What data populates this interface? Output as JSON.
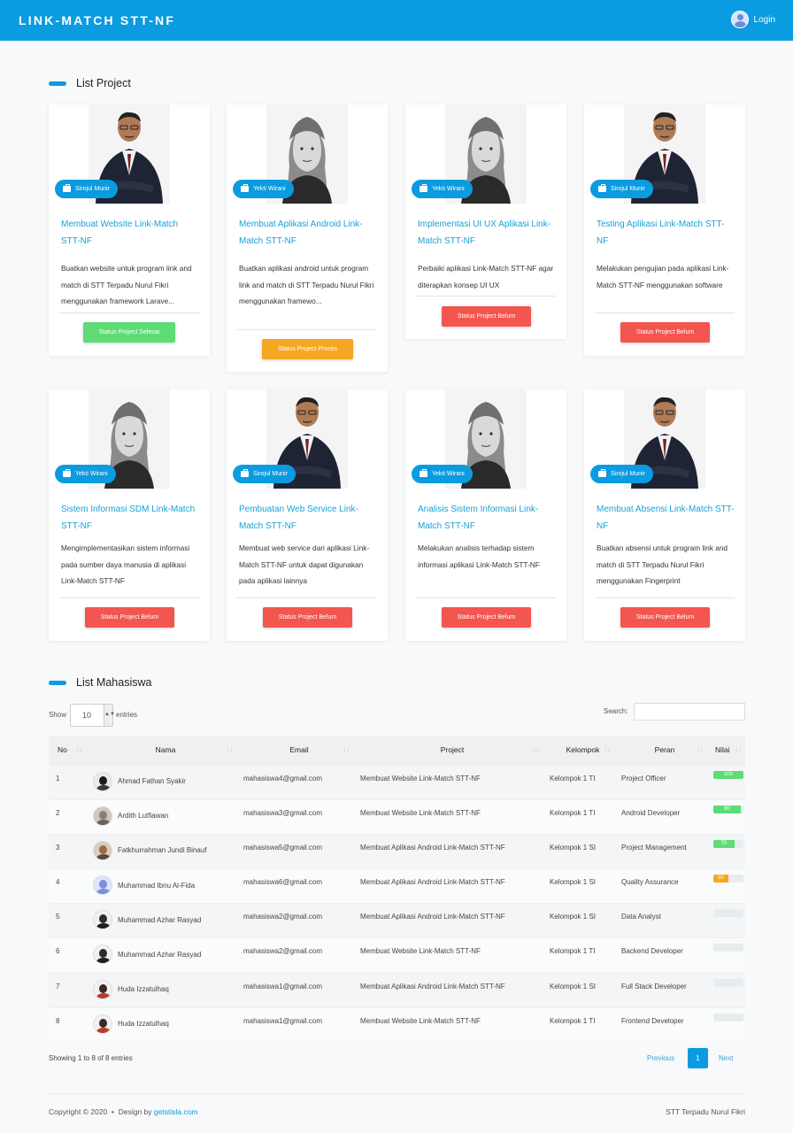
{
  "brand": "LINK-MATCH STT-NF",
  "login_label": "Login",
  "sections": {
    "projects": "List Project",
    "students": "List Mahasiswa"
  },
  "colors": {
    "primary": "#0b9be0",
    "selesai": "#5fdb76",
    "proses": "#f5a623",
    "belum": "#f2564f"
  },
  "projects": [
    {
      "owner": "Sirojul Munir",
      "owner_gender": "male",
      "title": "Membuat Website Link-Match STT-NF",
      "desc": "Buatkan website untuk program link and match di STT Terpadu Nurul Fikri menggunakan framework Larave...",
      "status": "Status Project Selesai",
      "status_type": "selesai"
    },
    {
      "owner": "Yekti Wirani",
      "owner_gender": "female",
      "title": "Membuat Aplikasi Android Link-Match STT-NF",
      "desc": "Buatkan aplikasi android untuk program link and match di STT Terpadu Nurul Fikri menggunakan framewo...",
      "status": "Status Project Proses",
      "status_type": "proses"
    },
    {
      "owner": "Yekti Wirani",
      "owner_gender": "female",
      "title": "Implementasi UI UX Aplikasi Link-Match STT-NF",
      "desc": "Perbaiki aplikasi Link-Match STT-NF agar diterapkan konsep UI UX",
      "status": "Status Project Belum",
      "status_type": "belum"
    },
    {
      "owner": "Sirojul Munir",
      "owner_gender": "male",
      "title": "Testing Aplikasi Link-Match STT-NF",
      "desc": "Melakukan pengujian pada aplikasi Link-Match STT-NF menggunakan software",
      "status": "Status Project Belum",
      "status_type": "belum"
    },
    {
      "owner": "Yekti Wirani",
      "owner_gender": "female",
      "title": "Sistem Informasi SDM Link-Match STT-NF",
      "desc": "Mengimplementasikan sistem informasi pada sumber daya manusia di aplikasi Link-Match STT-NF",
      "status": "Status Project Belum",
      "status_type": "belum"
    },
    {
      "owner": "Sirojul Munir",
      "owner_gender": "male",
      "title": "Pembuatan Web Service Link-Match STT-NF",
      "desc": "Membuat web service dari aplikasi Link-Match STT-NF untuk dapat digunakan pada aplikasi lainnya",
      "status": "Status Project Belum",
      "status_type": "belum"
    },
    {
      "owner": "Yekti Wirani",
      "owner_gender": "female",
      "title": "Analisis Sistem Informasi Link-Match STT-NF",
      "desc": "Melakukan analisis terhadap sistem informasi aplikasi Link-Match STT-NF",
      "status": "Status Project Belum",
      "status_type": "belum"
    },
    {
      "owner": "Sirojul Munir",
      "owner_gender": "male",
      "title": "Membuat Absensi Link-Match STT-NF",
      "desc": "Buatkan absensi untuk program link and match di STT Terpadu Nurul Fikri menggunakan Fingerprint",
      "status": "Status Project Belum",
      "status_type": "belum"
    }
  ],
  "table": {
    "show_label": "Show",
    "entries_value": "10",
    "entries_label": "entries",
    "search_label": "Search:",
    "search_value": "",
    "columns": [
      "No",
      "Nama",
      "Email",
      "Project",
      "Kelompok",
      "Peran",
      "Nilai"
    ],
    "rows": [
      {
        "no": "1",
        "nama": "Ahmad Fathan Syakir",
        "email": "mahasiswa4@gmail.com",
        "project": "Membuat Website Link-Match STT-NF",
        "kelompok": "Kelompok 1 TI",
        "peran": "Project Officer",
        "nilai": 100,
        "nilai_label": "100",
        "nilai_color": "#5fdb76",
        "avatar": "dark"
      },
      {
        "no": "2",
        "nama": "Ardith Lutfiawan",
        "email": "mahasiswa3@gmail.com",
        "project": "Membuat Website Link-Match STT-NF",
        "kelompok": "Kelompok 1 TI",
        "peran": "Android Developer",
        "nilai": 90,
        "nilai_label": "90",
        "nilai_color": "#5fdb76",
        "avatar": "grey"
      },
      {
        "no": "3",
        "nama": "Fatkhurrahman Jundi Binauf",
        "email": "mahasiswa5@gmail.com",
        "project": "Membuat Aplikasi Android Link-Match STT-NF",
        "kelompok": "Kelompok 1 SI",
        "peran": "Project Management",
        "nilai": 70,
        "nilai_label": "70",
        "nilai_color": "#5fdb76",
        "avatar": "tan"
      },
      {
        "no": "4",
        "nama": "Muhammad Ibnu Al-Fida",
        "email": "mahasiswa6@gmail.com",
        "project": "Membuat Aplikasi Android Link-Match STT-NF",
        "kelompok": "Kelompok 1 SI",
        "peran": "Quality Assurance",
        "nilai": 50,
        "nilai_label": "50",
        "nilai_color": "#f5a623",
        "avatar": "default"
      },
      {
        "no": "5",
        "nama": "Muhammad Azhar Rasyad",
        "email": "mahasiswa2@gmail.com",
        "project": "Membuat Aplikasi Android Link-Match STT-NF",
        "kelompok": "Kelompok 1 SI",
        "peran": "Data Analyst",
        "nilai": 0,
        "nilai_label": "",
        "nilai_color": "#5fdb76",
        "avatar": "photo"
      },
      {
        "no": "6",
        "nama": "Muhammad Azhar Rasyad",
        "email": "mahasiswa2@gmail.com",
        "project": "Membuat Website Link-Match STT-NF",
        "kelompok": "Kelompok 1 TI",
        "peran": "Backend Developer",
        "nilai": 0,
        "nilai_label": "",
        "nilai_color": "#5fdb76",
        "avatar": "photo"
      },
      {
        "no": "7",
        "nama": "Huda Izzatulhaq",
        "email": "mahasiswa1@gmail.com",
        "project": "Membuat Aplikasi Android Link-Match STT-NF",
        "kelompok": "Kelompok 1 SI",
        "peran": "Full Stack Developer",
        "nilai": 0,
        "nilai_label": "",
        "nilai_color": "#5fdb76",
        "avatar": "red"
      },
      {
        "no": "8",
        "nama": "Huda Izzatulhaq",
        "email": "mahasiswa1@gmail.com",
        "project": "Membuat Website Link-Match STT-NF",
        "kelompok": "Kelompok 1 TI",
        "peran": "Frontend Developer",
        "nilai": 0,
        "nilai_label": "",
        "nilai_color": "#5fdb76",
        "avatar": "red"
      }
    ],
    "info": "Showing 1 to 8 of 8 entries",
    "pagination": {
      "prev": "Previous",
      "current": "1",
      "next": "Next"
    }
  },
  "footer": {
    "copyright": "Copyright © 2020",
    "design_by": "Design by",
    "design_link": "getstisla.com",
    "right": "STT Terpadu Nurul Fikri"
  }
}
